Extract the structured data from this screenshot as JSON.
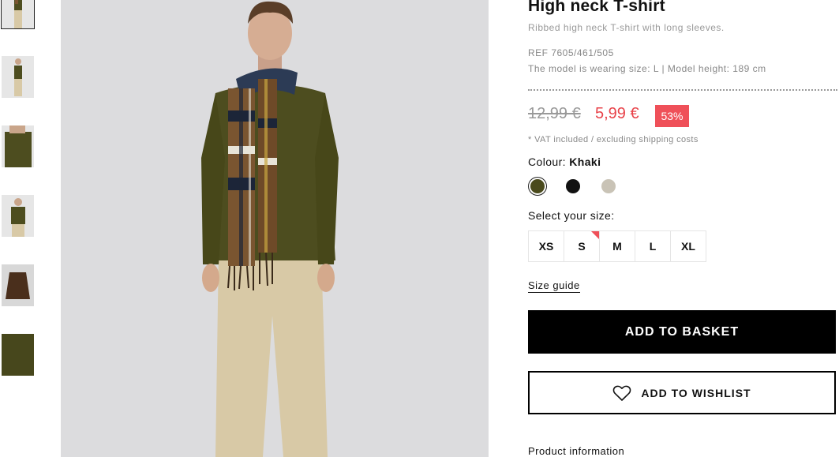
{
  "thumbnails": [
    {
      "name": "thumbnail-1",
      "selected": true
    },
    {
      "name": "thumbnail-2",
      "selected": false
    },
    {
      "name": "thumbnail-3",
      "selected": false
    },
    {
      "name": "thumbnail-4",
      "selected": false
    },
    {
      "name": "thumbnail-5",
      "selected": false
    },
    {
      "name": "thumbnail-6",
      "selected": false
    }
  ],
  "product": {
    "title": "High neck T-shirt",
    "subtitle": "Ribbed high neck T-shirt with long sleeves.",
    "ref": "REF 7605/461/505",
    "model_info": "The model is wearing size: L | Model height: 189 cm",
    "old_price": "12,99 €",
    "new_price": "5,99 €",
    "discount": "53%",
    "vat_note": "* VAT included / excluding shipping costs",
    "colour_label": "Colour:",
    "colour_value": "Khaki",
    "colours": [
      {
        "name": "Khaki",
        "hex": "#4a4a1c",
        "selected": true
      },
      {
        "name": "Black",
        "hex": "#111111",
        "selected": false
      },
      {
        "name": "Stone",
        "hex": "#c9c3b6",
        "selected": false
      }
    ],
    "size_label": "Select your size:",
    "sizes": [
      {
        "label": "XS",
        "low_stock": false
      },
      {
        "label": "S",
        "low_stock": true
      },
      {
        "label": "M",
        "low_stock": false
      },
      {
        "label": "L",
        "low_stock": false
      },
      {
        "label": "XL",
        "low_stock": false
      }
    ],
    "size_guide": "Size guide",
    "add_to_basket": "ADD TO BASKET",
    "add_to_wishlist": "ADD TO WISHLIST",
    "product_information": "Product information"
  },
  "colors": {
    "accent_red": "#ef5059",
    "shirt_khaki": "#4d4d1f",
    "trousers_beige": "#d8c9a6"
  }
}
